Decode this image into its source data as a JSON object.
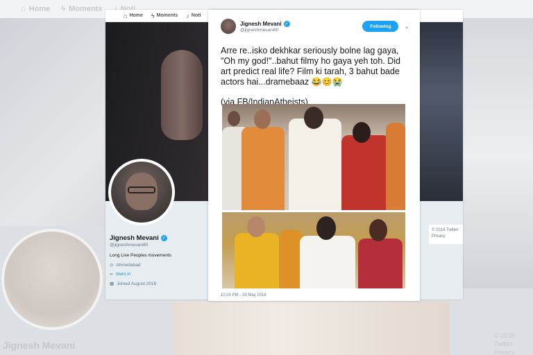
{
  "backdrop": {
    "nav": {
      "home": "Home",
      "moments": "Moments",
      "notifications": "Noti"
    },
    "name": "Jignesh Mevani",
    "copyright": "© 2018 Twitter",
    "privacy": "Privacy"
  },
  "profile": {
    "nav": {
      "home": "Home",
      "moments": "Moments",
      "notifications": "Noti"
    },
    "name": "Jignesh Mevani",
    "handle": "@jigneshmevani80",
    "bio": "Long Live Peoples movements",
    "location": "Ahmedabad",
    "website": "rdam.in",
    "joined": "Joined August 2016",
    "footer_copyright": "© 2018 Twitter",
    "footer_privacy": "Privacy"
  },
  "tweet": {
    "author_name": "Jignesh Mevani",
    "author_handle": "@jigneshmevani80",
    "follow_label": "Following",
    "text": "Arre re..isko dekhkar seriously bolne lag gaya, \"Oh my god!\"..bahut filmy ho gaya yeh toh. Did art predict real life? Film ki tarah, 3 bahut bade actors hai...dramebaaz",
    "emojis": "😂😊😭",
    "via": "(via FB/IndianAtheists)",
    "timestamp": "10:24 PM - 29 May 2018"
  },
  "colors": {
    "twitter_blue": "#1da1f2",
    "link_blue": "#1b95e0",
    "muted_text": "#657786"
  },
  "icons": [
    "home-icon",
    "bolt-icon",
    "bell-icon",
    "verified-icon",
    "location-icon",
    "link-icon",
    "calendar-icon",
    "chevron-down-icon"
  ]
}
